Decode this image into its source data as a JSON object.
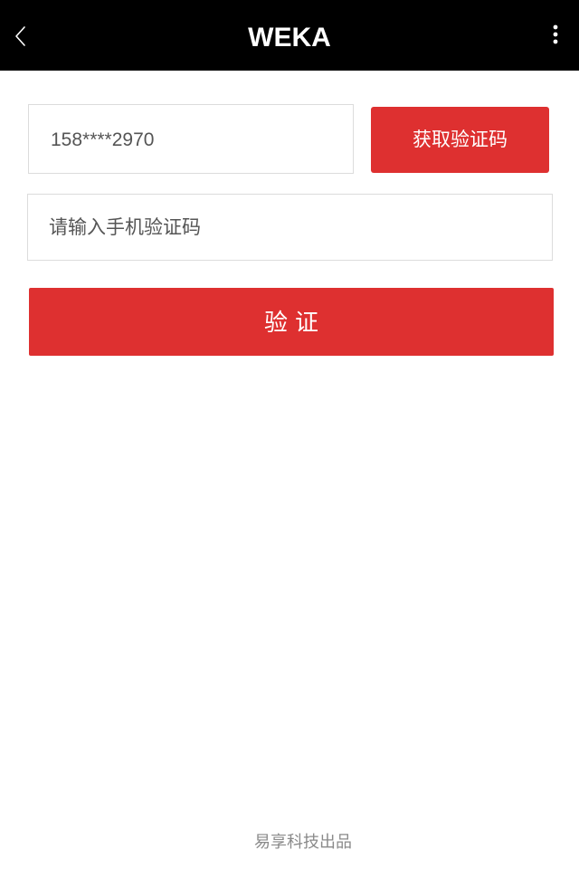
{
  "navbar": {
    "title": "WEKA",
    "back_icon": "chevron-left-icon",
    "more_icon": "more-vertical-icon",
    "background": "#000000",
    "title_color": "#ffffff"
  },
  "form": {
    "phone_value": "158****2970",
    "get_code_label": "获取验证码",
    "code_placeholder": "请输入手机验证码",
    "code_value": "",
    "verify_label": "验证"
  },
  "footer": {
    "credit": "易享科技出品"
  },
  "colors": {
    "accent": "#de3030",
    "border": "#dcdcdc",
    "muted_text": "#8a8a8a"
  }
}
